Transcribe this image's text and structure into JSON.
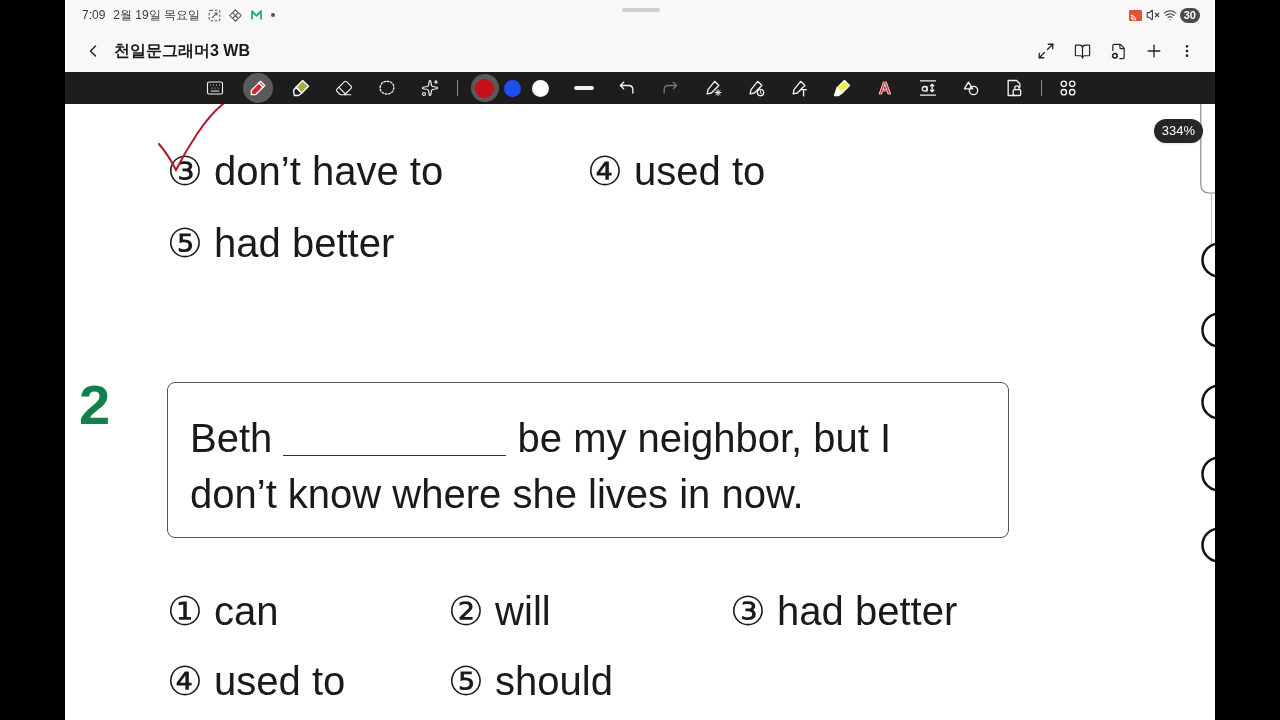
{
  "status_bar": {
    "time": "7:09",
    "date": "2월 19일 목요일",
    "battery": "30"
  },
  "header": {
    "title": "천일문그래머3 WB"
  },
  "toolbar": {
    "tools": [
      {
        "kind": "keyboard",
        "selected": false
      },
      {
        "kind": "pen",
        "selected": true
      },
      {
        "kind": "highlighter",
        "selected": false
      },
      {
        "kind": "eraser",
        "selected": false
      },
      {
        "kind": "lasso",
        "selected": false
      },
      {
        "kind": "ai_assist",
        "selected": false
      }
    ],
    "colors": [
      {
        "color": "#c8101c",
        "selected": true
      },
      {
        "color": "#1f4ff0",
        "selected": false
      },
      {
        "color": "#ffffff",
        "selected": false
      }
    ],
    "actions": [
      {
        "kind": "line_width",
        "disabled": false
      },
      {
        "kind": "undo",
        "disabled": false
      },
      {
        "kind": "redo",
        "disabled": true
      },
      {
        "kind": "pen_effect",
        "disabled": false
      },
      {
        "kind": "pen_shape",
        "disabled": false
      },
      {
        "kind": "pen_text",
        "disabled": false
      },
      {
        "kind": "highlighter_yellow",
        "disabled": false
      },
      {
        "kind": "text_style",
        "glyph": "A",
        "disabled": false
      },
      {
        "kind": "text_spacing",
        "disabled": false
      },
      {
        "kind": "shapes",
        "disabled": false
      },
      {
        "kind": "page_lock",
        "disabled": false
      }
    ],
    "extras": [
      {
        "kind": "apps"
      }
    ]
  },
  "zoom": "334%",
  "question_1": {
    "options": [
      {
        "label": "③ don’t have to"
      },
      {
        "label": "④ used to"
      },
      {
        "label": "⑤ had better"
      }
    ]
  },
  "question_2": {
    "number": "2",
    "sentence": {
      "before": "Beth",
      "after": "be my neighbor, but I don’t know where she lives in now."
    },
    "options": [
      {
        "label": "① can"
      },
      {
        "label": "② will"
      },
      {
        "label": "③ had better"
      },
      {
        "label": "④ used to"
      },
      {
        "label": "⑤ should"
      }
    ]
  }
}
